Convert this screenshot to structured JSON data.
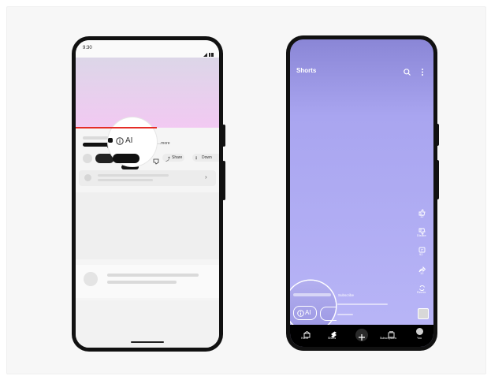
{
  "phone_left": {
    "status_time": "9:30",
    "ai_badge": "AI",
    "more_label": "...more",
    "share_label": "Share",
    "download_label": "Down"
  },
  "phone_right": {
    "title": "Shorts",
    "subscribe_label": "Subscribe",
    "ai_badge": "AI",
    "actions": [
      {
        "icon": "like-icon",
        "label": "12"
      },
      {
        "icon": "dislike-icon",
        "label": "Dislike"
      },
      {
        "icon": "comment-icon",
        "label": "92"
      },
      {
        "icon": "share-icon",
        "label": "12"
      },
      {
        "icon": "remix-icon",
        "label": "Remix"
      }
    ],
    "nav": [
      {
        "icon": "home-icon",
        "label": "Home"
      },
      {
        "icon": "shorts-icon",
        "label": "Shorts"
      },
      {
        "icon": "create-icon",
        "label": ""
      },
      {
        "icon": "subscriptions-icon",
        "label": "Subscriptions"
      },
      {
        "icon": "you-icon",
        "label": "You"
      }
    ]
  },
  "colors": {
    "video_gradient_top": "#dcd6e8",
    "video_gradient_bottom": "#f2c9f2",
    "progress_red": "#e52d27",
    "shorts_gradient_top": "#8a86d6",
    "shorts_gradient_bottom": "#b9b6f7"
  }
}
